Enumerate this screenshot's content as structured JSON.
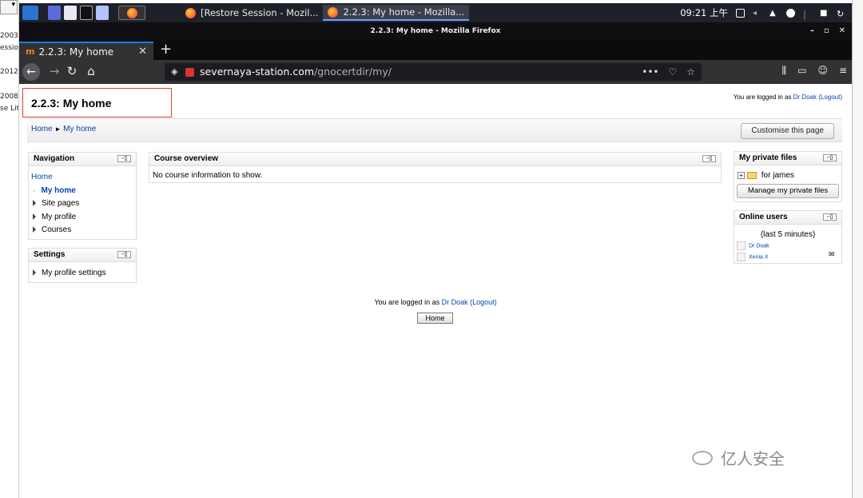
{
  "background_left": {
    "dropdown_arrow": "▾",
    "snippets": [
      "2003",
      "essio",
      "2012",
      "2008",
      "se Lit"
    ]
  },
  "taskbar": {
    "tasks": [
      {
        "label": "[Restore Session - Mozil..."
      },
      {
        "label": "2.2.3: My home - Mozilla..."
      }
    ],
    "clock": "09:21 上午"
  },
  "window": {
    "title": "2.2.3: My home - Mozilla Firefox",
    "controls": {
      "minimize": "–",
      "maximize": "▫",
      "close": "✕"
    }
  },
  "browser": {
    "tab": {
      "favicon": "m",
      "title": "2.2.3: My home",
      "close": "✕"
    },
    "new_tab": "+",
    "url_domain": "severnaya-station.com",
    "url_path": "/gnocertdir/my/",
    "url_dots": "•••"
  },
  "page": {
    "title": "2.2.3: My home",
    "login": {
      "prefix": "You are logged in as ",
      "user": "Dr Doak",
      "logout": "(Logout)"
    },
    "breadcrumb": {
      "home": "Home",
      "sep": "►",
      "current": "My home"
    },
    "customise_button": "Customise this page",
    "navigation": {
      "title": "Navigation",
      "home": "Home",
      "items": [
        "My home",
        "Site pages",
        "My profile",
        "Courses"
      ]
    },
    "settings": {
      "title": "Settings",
      "items": [
        "My profile settings"
      ]
    },
    "course_overview": {
      "title": "Course overview",
      "empty": "No course information to show."
    },
    "private_files": {
      "title": "My private files",
      "folder": "for james",
      "manage_button": "Manage my private files"
    },
    "online_users": {
      "title": "Online users",
      "period": "(last 5 minutes)",
      "users": [
        "Dr Doak",
        "Xenia X"
      ]
    },
    "footer": {
      "prefix": "You are logged in as ",
      "user": "Dr Doak",
      "logout": "(Logout)",
      "home_button": "Home"
    }
  },
  "watermark": "亿人安全"
}
